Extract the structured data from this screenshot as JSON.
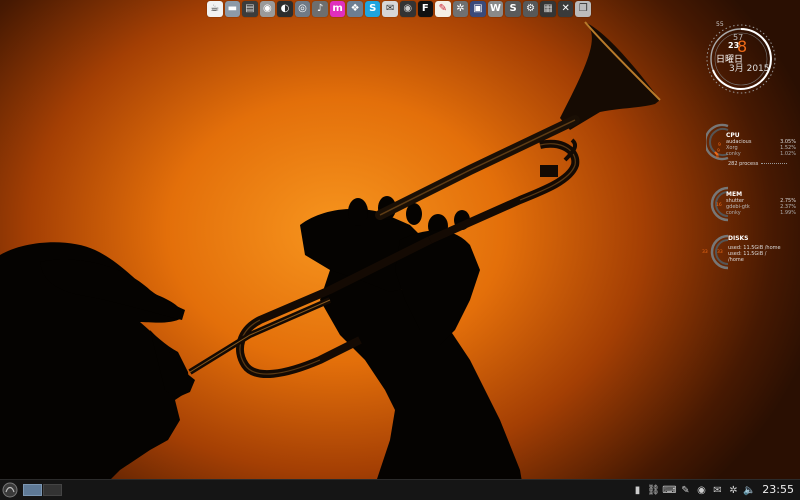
{
  "dock": {
    "items": [
      {
        "name": "coffee-icon",
        "glyph": "☕",
        "bg": "#f2f2f2",
        "fg": "#222"
      },
      {
        "name": "folder-icon",
        "glyph": "▬",
        "bg": "#8d9aa8",
        "fg": "#fff"
      },
      {
        "name": "printer-icon",
        "glyph": "▤",
        "bg": "#3c3c3c",
        "fg": "#ddd"
      },
      {
        "name": "chrome-icon",
        "glyph": "◉",
        "bg": "#9a9a9a",
        "fg": "#fff"
      },
      {
        "name": "inkscape-icon",
        "glyph": "◐",
        "bg": "#2d2d2d",
        "fg": "#fff"
      },
      {
        "name": "rss-icon",
        "glyph": "◎",
        "bg": "#707a86",
        "fg": "#fff"
      },
      {
        "name": "music-icon",
        "glyph": "♪",
        "bg": "#6e6e6e",
        "fg": "#fff"
      },
      {
        "name": "m-app-icon",
        "glyph": "m",
        "bg": "#e02fbd",
        "fg": "#fff"
      },
      {
        "name": "dropbox-icon",
        "glyph": "❖",
        "bg": "#6d7e92",
        "fg": "#fff"
      },
      {
        "name": "skype-icon",
        "glyph": "S",
        "bg": "#1fa5e0",
        "fg": "#fff"
      },
      {
        "name": "mail-icon",
        "glyph": "✉",
        "bg": "#d7d7d7",
        "fg": "#333"
      },
      {
        "name": "camera-icon",
        "glyph": "◉",
        "bg": "#333",
        "fg": "#ccc"
      },
      {
        "name": "f-app-icon",
        "glyph": "F",
        "bg": "#111",
        "fg": "#fff"
      },
      {
        "name": "gimp-icon",
        "glyph": "✎",
        "bg": "#f5f0e6",
        "fg": "#c23"
      },
      {
        "name": "settings-icon",
        "glyph": "✲",
        "bg": "#707070",
        "fg": "#fff"
      },
      {
        "name": "screenshot-icon",
        "glyph": "▣",
        "bg": "#3a4a7a",
        "fg": "#fff"
      },
      {
        "name": "writer-icon",
        "glyph": "W",
        "bg": "#8a8a8a",
        "fg": "#fff"
      },
      {
        "name": "s-app-icon",
        "glyph": "S",
        "bg": "#5a5a5a",
        "fg": "#fff"
      },
      {
        "name": "blender-icon",
        "glyph": "⚙",
        "bg": "#585858",
        "fg": "#fff"
      },
      {
        "name": "grid-icon",
        "glyph": "▦",
        "bg": "#353535",
        "fg": "#ccc"
      },
      {
        "name": "close-app-icon",
        "glyph": "✕",
        "bg": "#3a3a3a",
        "fg": "#fff"
      },
      {
        "name": "windows-icon",
        "glyph": "❐",
        "bg": "#bcbcbc",
        "fg": "#333"
      }
    ]
  },
  "clock": {
    "seconds": "55",
    "minute": "57",
    "hour": "23",
    "day": "8",
    "weekday": "日曜日",
    "month_year": "3月 2015",
    "accent": "#ef6a18"
  },
  "cpu": {
    "title": "CPU",
    "rows": [
      {
        "name": "audacious",
        "value": "3.05%"
      },
      {
        "name": "Xorg",
        "value": "1.52%"
      },
      {
        "name": "conky",
        "value": "1.02%"
      }
    ],
    "ring_values": [
      "9",
      "9",
      "8"
    ],
    "processes": "282 process"
  },
  "mem": {
    "title": "MEM",
    "rows": [
      {
        "name": "shutter",
        "value": "2.75%"
      },
      {
        "name": "gdebi-gtk",
        "value": "2.37%"
      },
      {
        "name": "conky",
        "value": "1.99%"
      }
    ],
    "ring_value": "16"
  },
  "disks": {
    "title": "DISKS",
    "line1": "used: 11.5GiB /home",
    "line2": "used: 11.5GiB /",
    "line3": "/home",
    "ring_values": [
      "33",
      "33"
    ]
  },
  "taskbar": {
    "tray": [
      {
        "name": "battery-icon",
        "glyph": "▮"
      },
      {
        "name": "link-icon",
        "glyph": "⛓"
      },
      {
        "name": "keyboard-icon",
        "glyph": "⌨"
      },
      {
        "name": "pen-icon",
        "glyph": "✎"
      },
      {
        "name": "record-icon",
        "glyph": "◉"
      },
      {
        "name": "mail-tray-icon",
        "glyph": "✉"
      },
      {
        "name": "update-icon",
        "glyph": "✲"
      },
      {
        "name": "volume-icon",
        "glyph": "🔈"
      }
    ],
    "time": "23:55"
  }
}
